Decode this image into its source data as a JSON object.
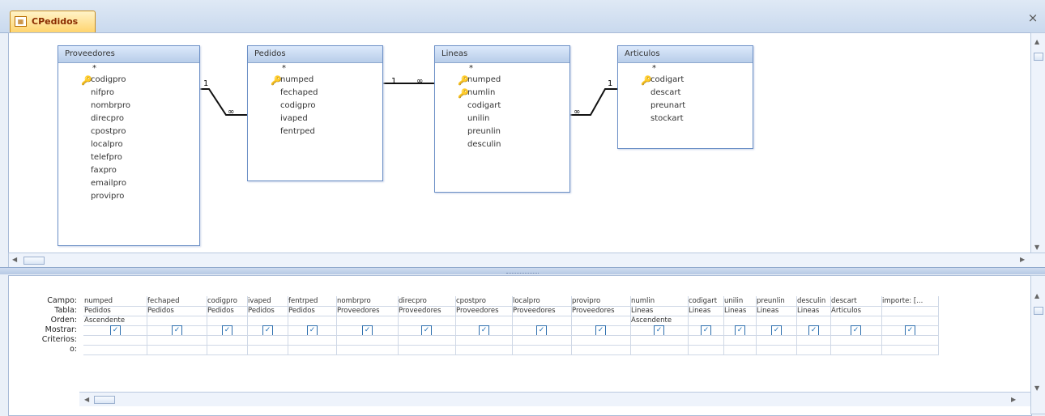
{
  "tab": {
    "label": "CPedidos",
    "icon": "query-icon"
  },
  "tables": [
    {
      "name": "Proveedores",
      "fields": [
        "*",
        "codigpro",
        "nifpro",
        "nombrpro",
        "direcpro",
        "cpostpro",
        "localpro",
        "telefpro",
        "faxpro",
        "emailpro",
        "provipro"
      ],
      "keys": [
        1
      ]
    },
    {
      "name": "Pedidos",
      "fields": [
        "*",
        "numped",
        "fechaped",
        "codigpro",
        "ivaped",
        "fentrped"
      ],
      "keys": [
        1
      ]
    },
    {
      "name": "Lineas",
      "fields": [
        "*",
        "numped",
        "numlin",
        "codigart",
        "unilin",
        "preunlin",
        "desculin"
      ],
      "keys": [
        1,
        2
      ]
    },
    {
      "name": "Articulos",
      "fields": [
        "*",
        "codigart",
        "descart",
        "preunart",
        "stockart"
      ],
      "keys": [
        1
      ]
    }
  ],
  "relationships": [
    {
      "from": "Proveedores",
      "to": "Pedidos",
      "one": "1",
      "many": "∞"
    },
    {
      "from": "Pedidos",
      "to": "Lineas",
      "one": "1",
      "many": "∞"
    },
    {
      "from": "Articulos",
      "to": "Lineas",
      "one": "1",
      "many": "∞"
    }
  ],
  "grid": {
    "row_labels": [
      "Campo:",
      "Tabla:",
      "Orden:",
      "Mostrar:",
      "Criterios:",
      "o:"
    ],
    "columns": [
      {
        "campo": "numped",
        "tabla": "Pedidos",
        "orden": "Ascendente",
        "mostrar": true
      },
      {
        "campo": "fechaped",
        "tabla": "Pedidos",
        "orden": "",
        "mostrar": true
      },
      {
        "campo": "codigpro",
        "tabla": "Pedidos",
        "orden": "",
        "mostrar": true
      },
      {
        "campo": "ivaped",
        "tabla": "Pedidos",
        "orden": "",
        "mostrar": true
      },
      {
        "campo": "fentrped",
        "tabla": "Pedidos",
        "orden": "",
        "mostrar": true
      },
      {
        "campo": "nombrpro",
        "tabla": "Proveedores",
        "orden": "",
        "mostrar": true
      },
      {
        "campo": "direcpro",
        "tabla": "Proveedores",
        "orden": "",
        "mostrar": true
      },
      {
        "campo": "cpostpro",
        "tabla": "Proveedores",
        "orden": "",
        "mostrar": true
      },
      {
        "campo": "localpro",
        "tabla": "Proveedores",
        "orden": "",
        "mostrar": true
      },
      {
        "campo": "provipro",
        "tabla": "Proveedores",
        "orden": "",
        "mostrar": true
      },
      {
        "campo": "numlin",
        "tabla": "Lineas",
        "orden": "Ascendente",
        "mostrar": true
      },
      {
        "campo": "codigart",
        "tabla": "Lineas",
        "orden": "",
        "mostrar": true
      },
      {
        "campo": "unilin",
        "tabla": "Lineas",
        "orden": "",
        "mostrar": true
      },
      {
        "campo": "preunlin",
        "tabla": "Lineas",
        "orden": "",
        "mostrar": true
      },
      {
        "campo": "desculin",
        "tabla": "Lineas",
        "orden": "",
        "mostrar": true
      },
      {
        "campo": "descart",
        "tabla": "Articulos",
        "orden": "",
        "mostrar": true
      },
      {
        "campo": "importe: [...",
        "tabla": "",
        "orden": "",
        "mostrar": true
      }
    ]
  },
  "scroll": {
    "up": "▲",
    "down": "▼",
    "left": "◀",
    "right": "▶"
  }
}
